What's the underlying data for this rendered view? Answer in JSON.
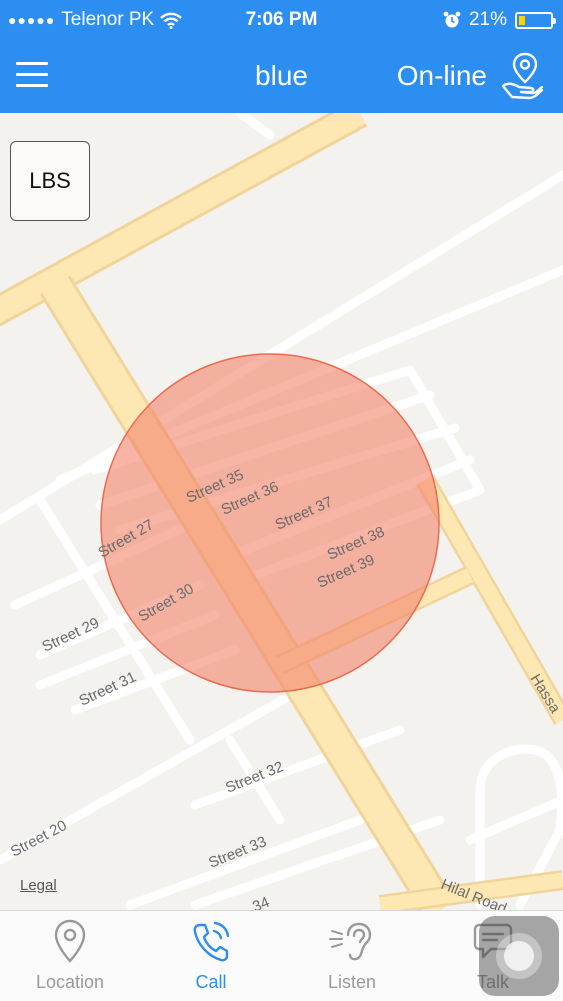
{
  "status_bar": {
    "signal": "●●●●●",
    "carrier": "Telenor PK",
    "time": "7:06 PM",
    "battery_percent": "21%",
    "battery_level": 0.21
  },
  "nav": {
    "title": "blue",
    "status": "On-line",
    "menu_icon": "hamburger-menu-icon",
    "location_icon": "location-pin-hand-icon"
  },
  "map": {
    "lbs_button": "LBS",
    "legal": "Legal",
    "accuracy_circle_color": "#f4846a",
    "street_labels": [
      "Street 35",
      "Street 36",
      "Street 37",
      "Street 38",
      "Street 39",
      "Street 27",
      "Street 30",
      "Street 29",
      "Street 31",
      "Street 32",
      "Street 20",
      "Street 33",
      "34",
      "Hassa",
      "Hilal Road"
    ]
  },
  "tabs": [
    {
      "label": "Location",
      "icon": "location-pin-icon",
      "active": false
    },
    {
      "label": "Call",
      "icon": "phone-call-icon",
      "active": true
    },
    {
      "label": "Listen",
      "icon": "ear-icon",
      "active": false
    },
    {
      "label": "Talk",
      "icon": "chat-bubble-icon",
      "active": false
    }
  ],
  "colors": {
    "primary": "#2b8ef0",
    "tab_inactive": "#999999",
    "map_background": "#f4f2ee",
    "major_road": "#fbe0a4"
  }
}
